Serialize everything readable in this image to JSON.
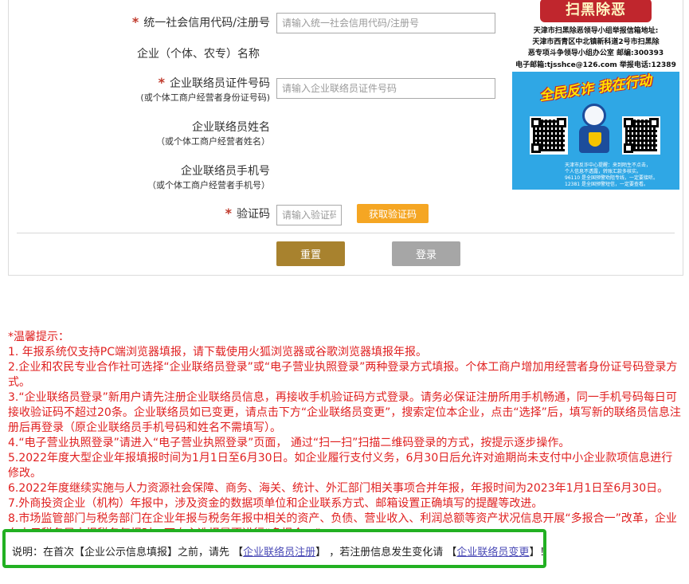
{
  "form": {
    "credit_code_label": "统一社会信用代码/注册号",
    "credit_code_placeholder": "请输入统一社会信用代码/注册号",
    "company_name_label": "企业（个体、农专）名称",
    "liaison_id_label": "企业联络员证件号码",
    "liaison_id_sub": "(或个体工商户经营者身份证号码)",
    "liaison_id_placeholder": "请输入企业联络员证件号码",
    "liaison_name_label": "企业联络员姓名",
    "liaison_name_sub": "（或个体工商户经营者姓名）",
    "liaison_phone_label": "企业联络员手机号",
    "liaison_phone_sub": "（或个体工商户经营者手机号）",
    "captcha_label": "验证码",
    "captcha_placeholder": "请输入验证码",
    "get_code_button": "获取验证码",
    "reset_button": "重置",
    "login_button": "登录",
    "required_mark": "*"
  },
  "poster": {
    "title": "扫黑除恶",
    "lines": [
      "天津市扫黑除恶领导小组举报信箱地址:",
      "天津市西青区中北镇新科道2号市扫黑除",
      "恶专项斗争领导小组办公室 邮编:300393",
      "电子邮箱:tjsshce@126.com 举报电话:12389"
    ],
    "slogan": "全民反诈 我在行动",
    "small_lines": [
      "天津市反诈中心提醒：来到陌生不点击，",
      "个人信息不透露，转账汇款多核实。",
      "96110 是全国预警劝阻专线，一定要接听。",
      "12381 是全国预警短信，一定要查看。"
    ]
  },
  "notice": {
    "lines": [
      "*温馨提示：",
      "1. 年报系统仅支持PC端浏览器填报，请下载使用火狐浏览器或谷歌浏览器填报年报。",
      "2.企业和农民专业合作社可选择“企业联络员登录”或“电子营业执照登录”两种登录方式填报。个体工商户增加用经营者身份证号码登录方式。",
      "3.“企业联络员登录”新用户请先注册企业联络员信息，再接收手机验证码方式登录。请务必保证注册所用手机畅通，同一手机号码每日可接收验证码不超过20条。企业联络员如已变更，请点击下方“企业联络员变更”，搜索定位本企业，点击“选择”后，填写新的联络员信息注册后再登录（原企业联络员手机号码和姓名不需填写）。",
      "4.“电子营业执照登录”请进入“电子营业执照登录”页面， 通过“扫一扫”扫描二维码登录的方式，按提示逐步操作。",
      "5.2022年度大型企业年报填报时间为1月1日至6月30日。如企业履行支付义务，6月30日后允许对逾期尚未支付中小企业款项信息进行修改。",
      "6.2022年度继续实施与人力资源社会保障、商务、海关、统计、外汇部门相关事项合并年报，年报时间为2023年1月1日至6月30日。",
      "7.外商投资企业（机构）年报中，涉及资金的数据项单位和企业联系方式、邮箱设置正确填写的提醒等改进。",
      "8.市场监管部门与税务部门在企业年报与税务年报中相关的资产、负债、营业收入、利润总额等资产状况信息开展“多报合一”改革，企业在电子税务局申报税务年报时，可自主选择是否进行“多报合一”。"
    ],
    "note_prefix": "说明：在首次【企业公示信息填报】之前，请先 【",
    "note_link1": "企业联络员注册",
    "note_middle": "】 ，若注册信息发生变化请 【",
    "note_link2": "企业联络员变更",
    "note_suffix": "】！"
  },
  "colors": {
    "required": "#c0392b",
    "notice_text": "#e02020",
    "reset_button": "#a8822e",
    "login_button": "#a6a6a6",
    "code_button": "#f5a623",
    "note_border": "#22b022",
    "link": "#4a4ab6"
  }
}
